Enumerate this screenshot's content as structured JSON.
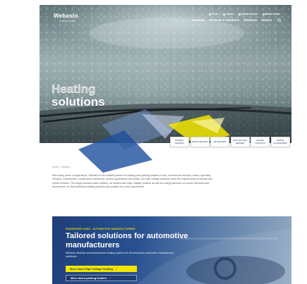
{
  "header": {
    "logo_name": "Webasto",
    "logo_tagline": "Feel the Drive",
    "utility_links": [
      "Press",
      "Career",
      "Dealer access",
      "Media Center"
    ],
    "main_nav": [
      "About Us",
      "Products & Solutions",
      "Solutions",
      "Service"
    ]
  },
  "hero": {
    "title_line1": "Heating",
    "title_line2": "solutions"
  },
  "category_tabs": [
    "Parking heaters",
    "Water heaters",
    "Air heaters",
    "High voltage heaters",
    "Heater controls",
    "Heater accessories"
  ],
  "breadcrumb": "Home > Heating",
  "intro_text": "With many years of experience, Webasto is the reliable partner for heating and parking heaters in cars, commercial vehicles, buses, specialty vehicles, motorhomes, construction machinery, marine applications and boats. Our high voltage solutions meet the requirements of electric and hybrid vehicles. The range includes water heaters, air heaters and High Voltage Heaters as well as a large selection of control elements and accessories, so that individual heating systems are possible for every requirement.",
  "banner": {
    "eyebrow": "PASSENGER CARS · AUTOMOTIVE MANUFACTURERS",
    "title": "Tailored solutions for automotive manufacturers",
    "text": "Webasto develops and manufactures heating systems for all well-known automotive manufacturers worldwide.",
    "button_primary": "More about High Voltage Heating",
    "button_secondary": "More about parking heaters"
  },
  "colors": {
    "accent_yellow": "#f2e500",
    "brand_blue": "#1d3d6b"
  }
}
